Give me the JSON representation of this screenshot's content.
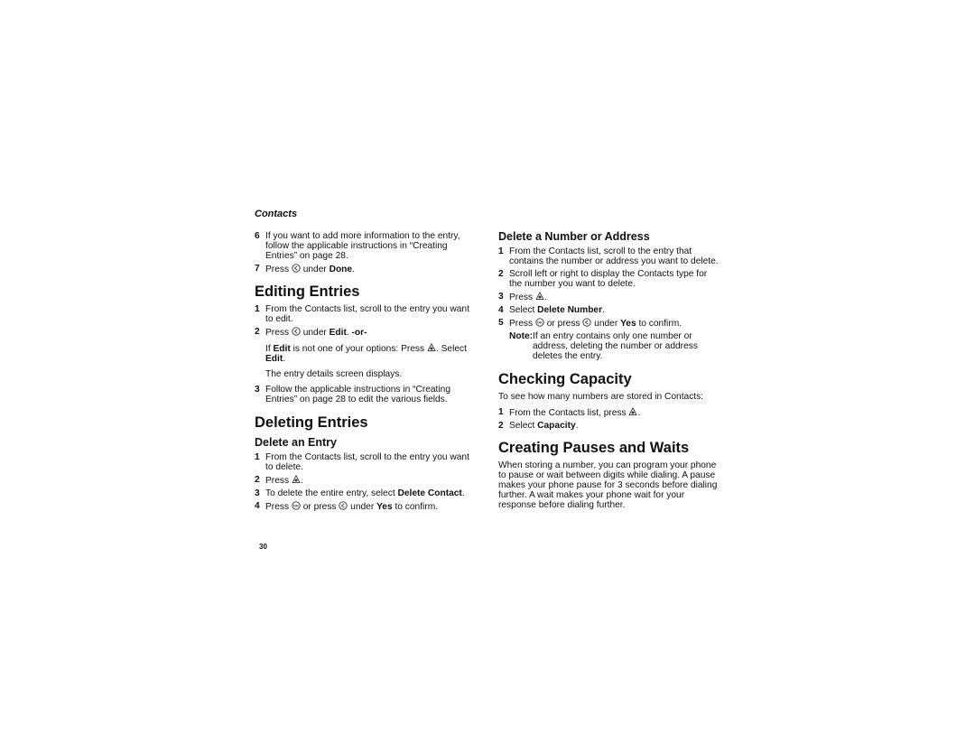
{
  "running_head": "Contacts",
  "page_number": "30",
  "left_column": {
    "continued_steps": [
      {
        "num": "6",
        "text": "If you want to add more information to the entry, follow the applicable instructions in “Creating Entries” on page 28."
      },
      {
        "num": "7",
        "pre": "Press ",
        "icon": "left-softkey-icon",
        "post": " under ",
        "bold": "Done",
        "tail": "."
      }
    ],
    "editing": {
      "title": "Editing Entries",
      "step1": {
        "num": "1",
        "text": "From the Contacts list, scroll to the entry you want to edit."
      },
      "step2": {
        "num": "2",
        "pre": "Press ",
        "post": " under ",
        "bold": "Edit",
        "mid": ". ",
        "bold2": "-or-"
      },
      "alt_pre": "If ",
      "alt_bold": "Edit",
      "alt_mid": " is not one of your options: Press ",
      "alt_post": ". Select ",
      "alt_bold2": "Edit",
      "alt_tail": ".",
      "result": "The entry details screen displays.",
      "step3": {
        "num": "3",
        "text": "Follow the applicable instructions in “Creating Entries” on page 28 to edit the various fields."
      }
    },
    "deleting": {
      "title": "Deleting Entries",
      "subtitle": "Delete an Entry",
      "step1": {
        "num": "1",
        "text": "From the Contacts list, scroll to the entry you want to delete."
      },
      "step2": {
        "num": "2",
        "pre": "Press ",
        "tail": "."
      },
      "step3": {
        "num": "3",
        "pre": "To delete the entire entry, select ",
        "bold": "Delete Contact",
        "tail": "."
      },
      "step4": {
        "num": "4",
        "pre": "Press ",
        "mid": " or press ",
        "post": " under ",
        "bold": "Yes",
        "tail": " to confirm."
      }
    }
  },
  "right_column": {
    "delete_number": {
      "subtitle": "Delete a Number or Address",
      "step1": {
        "num": "1",
        "text": "From the Contacts list, scroll to the entry that contains the number or address you want to delete."
      },
      "step2": {
        "num": "2",
        "text": "Scroll left or right to display the Contacts type for the number you want to delete."
      },
      "step3": {
        "num": "3",
        "pre": "Press ",
        "tail": "."
      },
      "step4": {
        "num": "4",
        "pre": "Select ",
        "bold": "Delete Number",
        "tail": "."
      },
      "step5": {
        "num": "5",
        "pre": "Press ",
        "mid": " or press ",
        "post": " under ",
        "bold": "Yes",
        "tail": " to confirm."
      },
      "note_label": "Note:",
      "note_text": "If an entry contains only one number or address, deleting the number or address deletes the entry."
    },
    "capacity": {
      "title": "Checking Capacity",
      "intro": "To see how many numbers are stored in Contacts:",
      "step1": {
        "num": "1",
        "pre": "From the Contacts list, press ",
        "tail": "."
      },
      "step2": {
        "num": "2",
        "pre": "Select ",
        "bold": "Capacity",
        "tail": "."
      }
    },
    "pauses": {
      "title": "Creating Pauses and Waits",
      "body": "When storing a number, you can program your phone to pause or wait between digits while dialing. A pause makes your phone pause for 3 seconds before dialing further. A wait makes your phone wait for your response before dialing further."
    }
  },
  "icons": {
    "left_softkey": "left-softkey-icon",
    "menu_key": "menu-key-icon",
    "ok_key": "ok-key-icon"
  }
}
